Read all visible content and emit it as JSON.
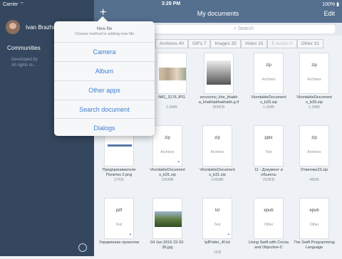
{
  "status": {
    "carrier": "Carrier ⌔",
    "time": "3:29 PM",
    "battery": "100% ▮"
  },
  "sidebar": {
    "username": "Ivan Brazhni",
    "communities": "Communities",
    "bg_line1": "Developed by",
    "bg_line2": "All rights re..."
  },
  "header": {
    "plus": "+",
    "title": "My documents",
    "edit": "Edit"
  },
  "search": {
    "placeholder": "Search"
  },
  "filters": [
    "Archives 40",
    "GIFs 7",
    "Images 35",
    "Video 15",
    "E-books 0",
    "Other 31"
  ],
  "popover": {
    "title": "New file",
    "subtitle": "Choose method to adding new file",
    "items": [
      "Camera",
      "Album",
      "Other apps",
      "Search document",
      "Dialogs"
    ]
  },
  "files": [
    {
      "name": "IMG_3176.JPG",
      "size": "2.6MB"
    },
    {
      "name": "serysvino_khe_khakh a_khakhakhakhakh.g if",
      "size": "806KB"
    },
    {
      "ext": "zip",
      "sub": "Archives",
      "name": "VkontakteDocument s_b33.zip",
      "size": "1.0MB"
    },
    {
      "ext": "zip",
      "sub": "Archives",
      "name": "VkontakteDocument s_b33.zip",
      "size": "1.0MB"
    },
    {
      "name": "Предприниматели Политех 2.png",
      "size": "27KB"
    },
    {
      "ext": "zip",
      "sub": "Archives",
      "name": "VkontakteDocument s_b31.zip",
      "size": "106MB"
    },
    {
      "ext": "zip",
      "sub": "Archives",
      "name": "VkontakteDocument s_b31.zip",
      "size": "106MB"
    },
    {
      "ext": "pptx",
      "sub": "Text",
      "name": "11 - Документ и объекты страницы.pptx",
      "size": "203KB"
    },
    {
      "ext": "zip",
      "sub": "Archives",
      "name": "Ответике23.zip",
      "size": "48KB"
    },
    {
      "ext": "pdf",
      "sub": "Text",
      "name": "Управление проектом",
      "size": ""
    },
    {
      "name": "04 Jan 2016 23-32-36.jpg",
      "size": ""
    },
    {
      "ext": "txt",
      "sub": "Text",
      "name": "lpfPotter_4f.txt",
      "size": "1KB"
    },
    {
      "ext": "epub",
      "sub": "Other",
      "name": "Using Swift with Cocoa and Objective-C",
      "size": ""
    },
    {
      "ext": "epub",
      "sub": "Other",
      "name": "The Swift Programming Language",
      "size": ""
    }
  ]
}
